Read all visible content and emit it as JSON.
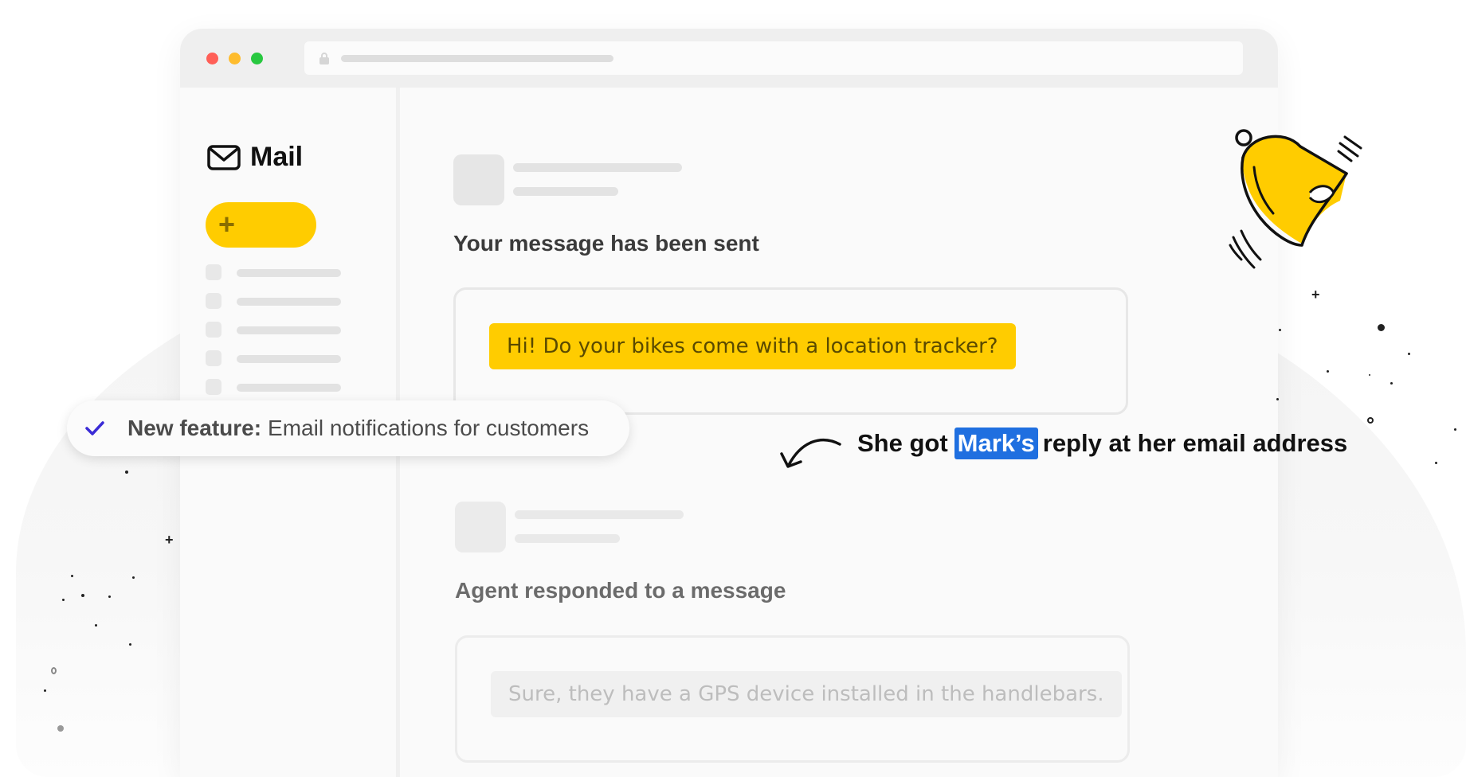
{
  "app": {
    "title": "Mail"
  },
  "colors": {
    "accent_yellow": "#ffcc00",
    "highlight_blue": "#1f6fe0",
    "check_purple": "#3a2bd6",
    "traffic_red": "#ff5f57",
    "traffic_yellow": "#febc2e",
    "traffic_green": "#28c840"
  },
  "icons": {
    "logo": "envelope-icon",
    "compose": "plus-icon",
    "address_bar": "lock-icon",
    "notification": "check-icon",
    "decoration": "bell-icon",
    "pointer": "curved-arrow-icon"
  },
  "messages": [
    {
      "status": "Your message has been sent",
      "body": "Hi! Do your bikes come with a location tracker?"
    },
    {
      "status": "Agent responded to a message",
      "body": "Sure, they have a GPS device installed in the handlebars."
    }
  ],
  "notification": {
    "bold": "New feature:",
    "text": "Email notifications for customers"
  },
  "annotation": {
    "before": "She got",
    "highlight": "Mark’s",
    "after": "reply at her email address"
  }
}
